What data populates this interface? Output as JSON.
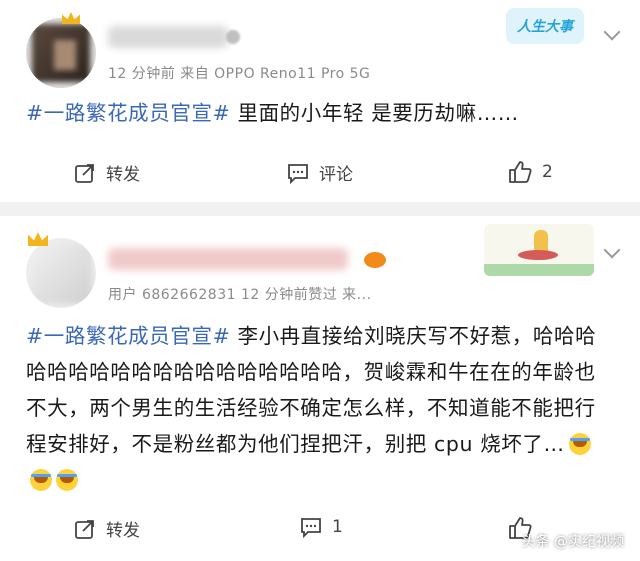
{
  "post1": {
    "meta": "12 分钟前  来自 OPPO Reno11 Pro 5G",
    "hashtag": "#一路繁花成员官宣#",
    "text": " 里面的小年轻  是要历劫嘛……",
    "repost_label": "转发",
    "comment_label": "评论",
    "like_count": "2",
    "badge_label": "人生大事"
  },
  "post2": {
    "meta": "用户 6862662831 12 分钟前赞过 来...",
    "hashtag": "#一路繁花成员官宣#",
    "text": " 李小冉直接给刘晓庆写不好惹，哈哈哈哈哈哈哈哈哈哈哈哈哈哈哈哈哈哈，贺峻霖和牛在在的年龄也不大，两个男生的生活经验不确定怎么样，不知道能不能把行程安排好，不是粉丝都为他们捏把汗，别把 cpu 烧坏了…",
    "repost_label": "转发",
    "comment_count": "1"
  },
  "watermark": "头条 @实纪视频",
  "colors": {
    "hashtag": "#3a68b8",
    "divider": "#f1f1f1",
    "meta": "#8a8a8a"
  }
}
